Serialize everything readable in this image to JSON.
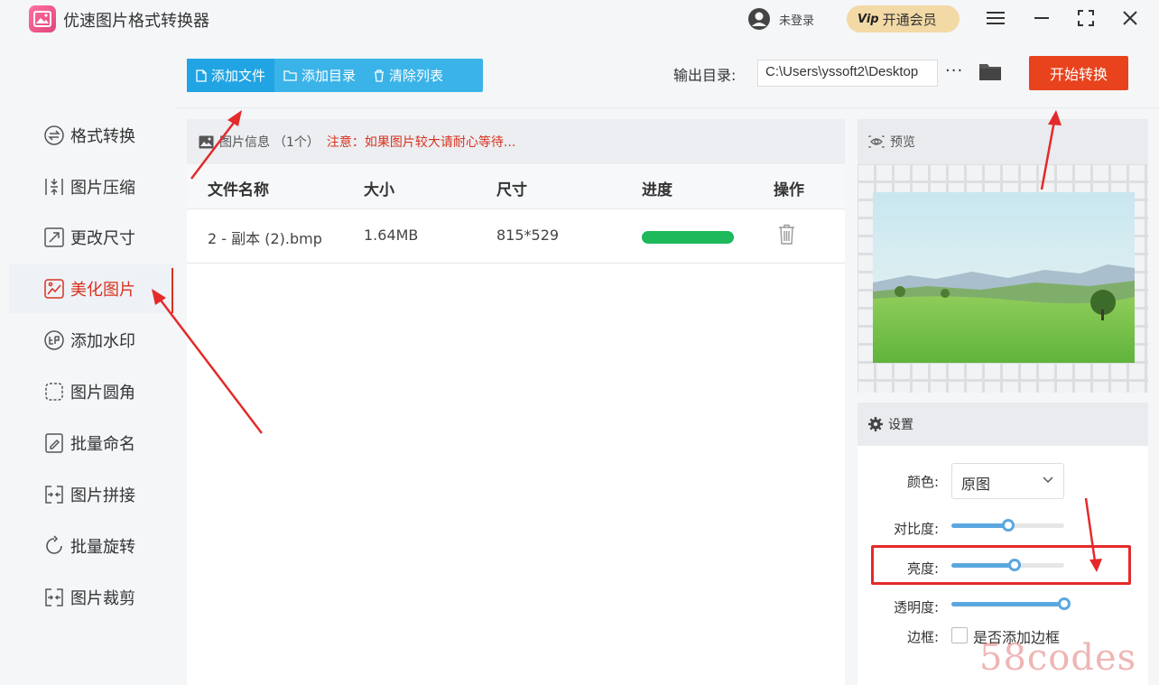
{
  "app": {
    "title": "优速图片格式转换器"
  },
  "user": {
    "login_text": "未登录"
  },
  "vip": {
    "badge": "Vip",
    "label": "开通会员"
  },
  "window": {
    "menu": "≡",
    "minimize": "—",
    "maximize": "⛶",
    "close": "✕"
  },
  "sidebar": {
    "items": [
      {
        "label": "格式转换",
        "icon": "swap-icon"
      },
      {
        "label": "图片压缩",
        "icon": "compress-icon"
      },
      {
        "label": "更改尺寸",
        "icon": "resize-icon"
      },
      {
        "label": "美化图片",
        "icon": "beautify-icon",
        "active": true
      },
      {
        "label": "添加水印",
        "icon": "watermark-icon"
      },
      {
        "label": "图片圆角",
        "icon": "rounded-corner-icon"
      },
      {
        "label": "批量命名",
        "icon": "rename-icon"
      },
      {
        "label": "图片拼接",
        "icon": "stitch-icon"
      },
      {
        "label": "批量旋转",
        "icon": "rotate-icon"
      },
      {
        "label": "图片裁剪",
        "icon": "crop-icon"
      }
    ]
  },
  "toolbar": {
    "add_file": "添加文件",
    "add_folder": "添加目录",
    "clear_list": "清除列表",
    "output_label": "输出目录:",
    "output_path": "C:\\Users\\yssoft2\\Desktop",
    "more": "···",
    "start": "开始转换"
  },
  "file_list": {
    "info_label": "图片信息",
    "count": "（1个）",
    "note": "注意：如果图片较大请耐心等待...",
    "columns": [
      "文件名称",
      "大小",
      "尺寸",
      "进度",
      "操作"
    ],
    "rows": [
      {
        "name": "2 - 副本 (2).bmp",
        "size": "1.64MB",
        "dimensions": "815*529",
        "progress": 1.0
      }
    ]
  },
  "preview": {
    "label": "预览"
  },
  "settings": {
    "label": "设置",
    "color_label": "颜色:",
    "color_value": "原图",
    "contrast_label": "对比度:",
    "contrast_value": 0.5,
    "brightness_label": "亮度:",
    "brightness_value": 0.56,
    "opacity_label": "透明度:",
    "opacity_value": 1.0,
    "border_label": "边框:",
    "border_checkbox_label": "是否添加边框",
    "border_checked": false
  },
  "watermark_text": "58codes",
  "colors": {
    "accent_blue": "#3ab3e8",
    "start_red": "#e8431d",
    "active_red": "#d9321f",
    "progress_green": "#1db95a"
  }
}
